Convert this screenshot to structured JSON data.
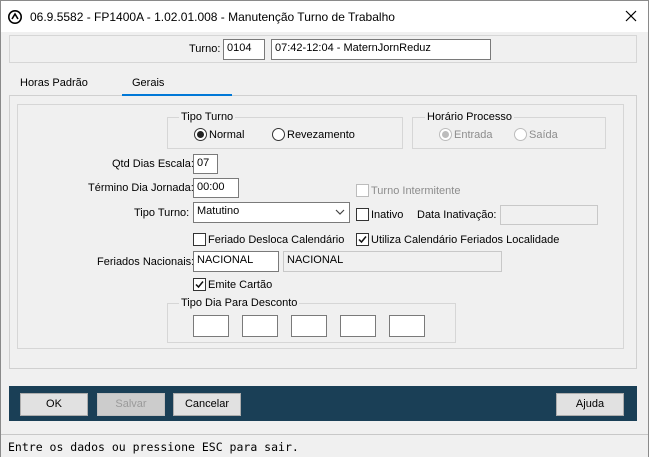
{
  "window": {
    "title": "06.9.5582 - FP1400A - 1.02.01.008 - Manutenção Turno de Trabalho"
  },
  "header": {
    "turno_label": "Turno:",
    "turno_code": "0104",
    "turno_desc": "07:42-12:04 - MaternJornReduz"
  },
  "tabs": [
    {
      "label": "Horas Padrão"
    },
    {
      "label": "Gerais"
    }
  ],
  "tipo_turno": {
    "title": "Tipo Turno",
    "normal": "Normal",
    "revezamento": "Revezamento",
    "selected": "Normal"
  },
  "horario_processo": {
    "title": "Horário Processo",
    "entrada": "Entrada",
    "saida": "Saída"
  },
  "fields": {
    "qtd_dias_label": "Qtd Dias Escala:",
    "qtd_dias_value": "07",
    "termino_label": "Término Dia Jornada:",
    "termino_value": "00:00",
    "tipo_turno_label": "Tipo Turno:",
    "tipo_turno_value": "Matutino",
    "turno_intermitente": "Turno Intermitente",
    "inativo": "Inativo",
    "data_inativacao_label": "Data Inativação:",
    "data_inativacao_value": "",
    "feriado_desloca": "Feriado Desloca Calendário",
    "utiliza_calendario": "Utiliza Calendário Feriados Localidade",
    "feriados_label": "Feriados Nacionais:",
    "feriados_code": "NACIONAL",
    "feriados_desc": "NACIONAL",
    "emite_cartao": "Emite Cartão",
    "tipo_dia_title": "Tipo Dia Para Desconto"
  },
  "checks": {
    "turno_intermitente": false,
    "inativo": false,
    "feriado_desloca": false,
    "utiliza_calendario": true,
    "emite_cartao": true
  },
  "buttons": {
    "ok": "OK",
    "salvar": "Salvar",
    "cancelar": "Cancelar",
    "ajuda": "Ajuda"
  },
  "status": {
    "text": "Entre os dados ou pressione ESC para sair."
  },
  "colors": {
    "bottom_bar": "#1a3f56",
    "tab_accent": "#0078d7"
  }
}
